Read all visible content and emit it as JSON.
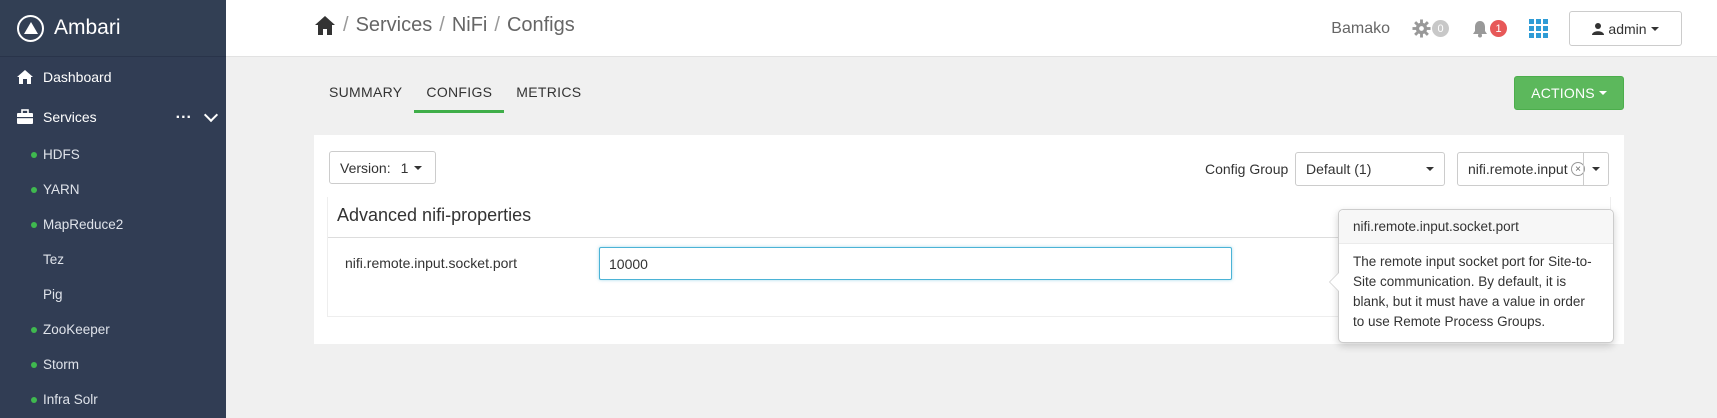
{
  "brand": {
    "name": "Ambari"
  },
  "sidebar": {
    "dashboard_label": "Dashboard",
    "services_label": "Services",
    "services_more": "...",
    "services": [
      {
        "label": "HDFS",
        "status": "green"
      },
      {
        "label": "YARN",
        "status": "green"
      },
      {
        "label": "MapReduce2",
        "status": "green"
      },
      {
        "label": "Tez",
        "status": "none"
      },
      {
        "label": "Pig",
        "status": "none"
      },
      {
        "label": "ZooKeeper",
        "status": "green"
      },
      {
        "label": "Storm",
        "status": "green"
      },
      {
        "label": "Infra Solr",
        "status": "green"
      }
    ]
  },
  "header": {
    "breadcrumb": [
      "Services",
      "NiFi",
      "Configs"
    ],
    "separator": "/",
    "cluster_name": "Bamako",
    "ops_count": "0",
    "alerts_count": "1",
    "user_label": "admin"
  },
  "tabs": [
    {
      "label": "SUMMARY",
      "active": false
    },
    {
      "label": "CONFIGS",
      "active": true
    },
    {
      "label": "METRICS",
      "active": false
    }
  ],
  "actions_label": "ACTIONS",
  "config": {
    "version_label": "Version:",
    "version_value": "1",
    "config_group_label": "Config Group",
    "config_group_value": "Default (1)",
    "filter_value": "nifi.remote.input",
    "section_title": "Advanced nifi-properties",
    "property_name": "nifi.remote.input.socket.port",
    "property_value": "10000"
  },
  "popover": {
    "title": "nifi.remote.input.socket.port",
    "body": "The remote input socket port for Site-to-Site communication. By default, it is blank, but it must have a value in order to use Remote Process Groups."
  },
  "colors": {
    "sidebar_bg": "#313d54",
    "accent_green": "#5cb85c",
    "status_green": "#3fb94f",
    "alert_red": "#e75858",
    "link_blue": "#2f9cd6"
  }
}
